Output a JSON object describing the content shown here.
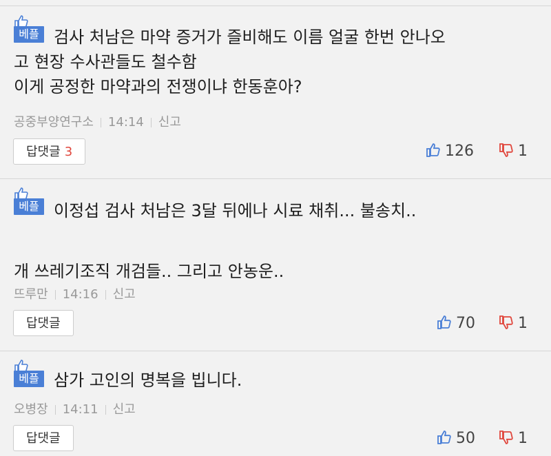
{
  "badge_label": "베플",
  "report_label": "신고",
  "reply_label": "답댓글",
  "colors": {
    "badge": "#4a7fd6",
    "reply_count": "#e0463c",
    "upvote_icon": "#4a7fd6",
    "downvote_icon": "#e0463c"
  },
  "comments": [
    {
      "text": "검사 처남은 마약 증거가 즐비해도 이름 얼굴 한번 안나오\n고 현장 수사관들도 철수함\n이게 공정한 마약과의 전쟁이냐 한동훈아?",
      "author": "공중부양연구소",
      "time": "14:14",
      "reply_count": "3",
      "upvotes": "126",
      "downvotes": "1"
    },
    {
      "text": "이정섭 검사 처남은 3달 뒤에나 시료 채취... 불송치..\n\n개 쓰레기조직 개검들.. 그리고 안농운..",
      "author": "뜨루만",
      "time": "14:16",
      "reply_count": "",
      "upvotes": "70",
      "downvotes": "1"
    },
    {
      "text": "삼가 고인의 명복을 빕니다.",
      "author": "오병장",
      "time": "14:11",
      "reply_count": "",
      "upvotes": "50",
      "downvotes": "1"
    }
  ]
}
